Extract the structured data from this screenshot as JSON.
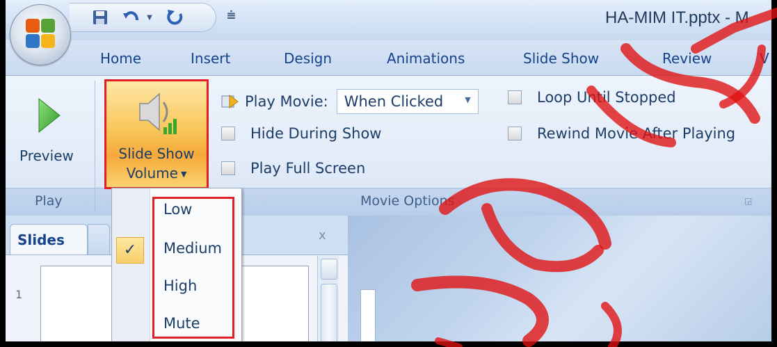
{
  "window": {
    "title": "HA-MIM IT.pptx - M"
  },
  "quick_access": {
    "icons": [
      "save-icon",
      "undo-icon",
      "redo-icon",
      "customize-icon"
    ]
  },
  "tabs": [
    {
      "label": "Home"
    },
    {
      "label": "Insert"
    },
    {
      "label": "Design"
    },
    {
      "label": "Animations"
    },
    {
      "label": "Slide Show"
    },
    {
      "label": "Review"
    },
    {
      "label": "V"
    }
  ],
  "ribbon": {
    "play_group": {
      "preview_label": "Preview",
      "label": "Play"
    },
    "slide_show_volume": {
      "line1": "Slide Show",
      "line2": "Volume"
    },
    "movie_options": {
      "label": "Movie Options",
      "play_movie_label": "Play Movie:",
      "play_movie_value": "When Clicked",
      "hide_during_show": "Hide During Show",
      "play_full_screen": "Play Full Screen",
      "loop_until_stopped": "Loop Until Stopped",
      "rewind_after_playing": "Rewind Movie After Playing"
    }
  },
  "volume_menu": {
    "items": [
      {
        "label": "Low",
        "checked": false
      },
      {
        "label": "Medium",
        "checked": true
      },
      {
        "label": "High",
        "checked": false
      },
      {
        "label": "Mute",
        "checked": false
      }
    ],
    "check_glyph": "✓"
  },
  "slides_pane": {
    "tab_label": "Slides",
    "close_glyph": "x",
    "slide_number": "1"
  },
  "colors": {
    "highlight_border": "#e02024",
    "ribbon_text": "#1b3d68",
    "tab_text": "#15428b"
  }
}
